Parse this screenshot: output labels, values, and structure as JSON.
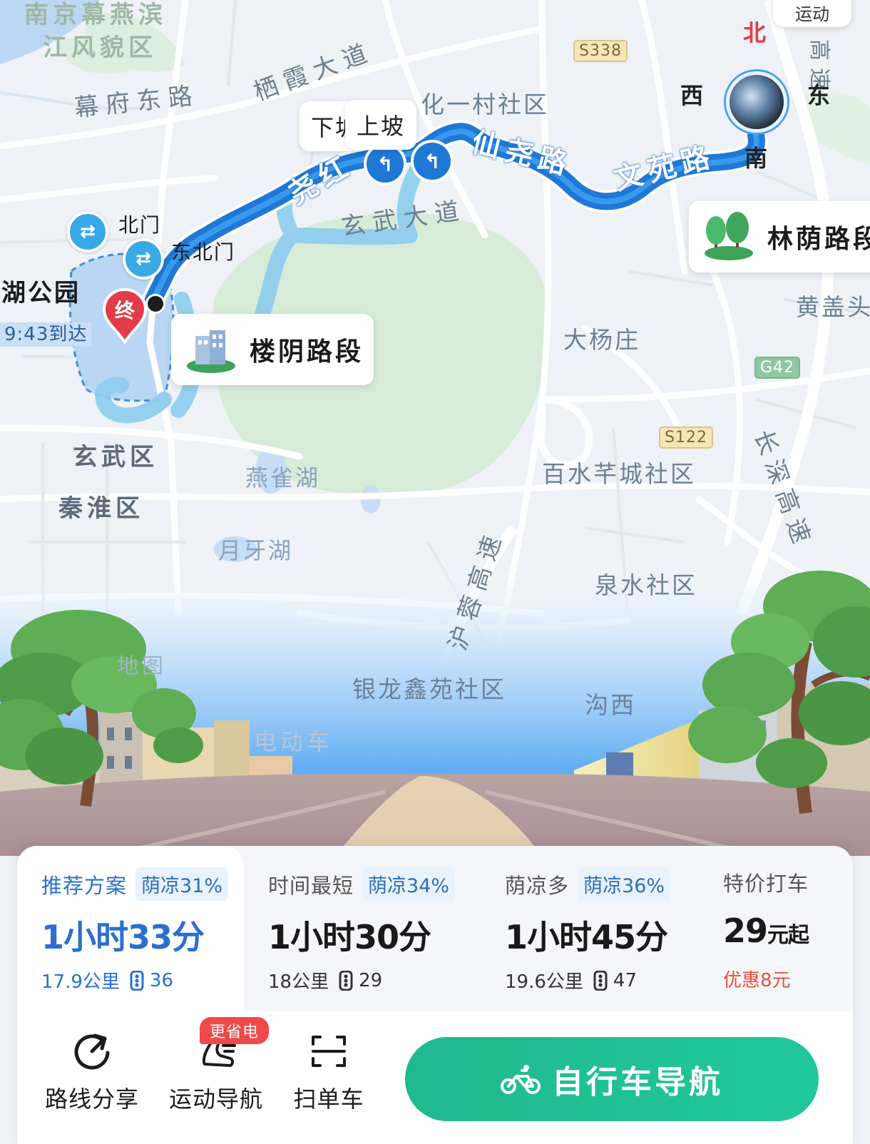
{
  "map": {
    "district_labels": [
      {
        "id": "scenic",
        "text": "南京幕燕滨"
      },
      {
        "id": "scenic2",
        "text": "江风貌区"
      },
      {
        "id": "xuanwu",
        "text": "玄武区"
      },
      {
        "id": "qinhuai",
        "text": "秦淮区"
      }
    ],
    "community_labels": [
      {
        "id": "c1",
        "text": "化一村社区"
      },
      {
        "id": "c2",
        "text": "大杨庄"
      },
      {
        "id": "c3",
        "text": "百水芊城社区"
      },
      {
        "id": "c4",
        "text": "泉水社区"
      },
      {
        "id": "c5",
        "text": "银龙鑫苑社区"
      },
      {
        "id": "c6",
        "text": "沟西"
      },
      {
        "id": "c7",
        "text": "黄盖头"
      }
    ],
    "road_labels": [
      {
        "id": "r1",
        "text": "幕府东路"
      },
      {
        "id": "r2",
        "text": "栖霞大道"
      },
      {
        "id": "r3",
        "text": "玄武大道"
      },
      {
        "id": "r4",
        "text": "长深高速"
      },
      {
        "id": "r5",
        "text": "沪蓉高速"
      },
      {
        "id": "r6",
        "text": "高速"
      }
    ],
    "route_road_labels": [
      {
        "id": "rr1",
        "text": "尧红"
      },
      {
        "id": "rr2",
        "text": "仙尧路"
      },
      {
        "id": "rr3",
        "text": "文苑路"
      }
    ],
    "water_labels": [
      {
        "id": "w1",
        "text": "燕雀湖"
      },
      {
        "id": "w2",
        "text": "月牙湖"
      }
    ],
    "place_labels": [
      {
        "id": "p1",
        "text": "湖公园"
      },
      {
        "id": "p2",
        "text": "北门"
      },
      {
        "id": "p3",
        "text": "东北门"
      },
      {
        "id": "p4",
        "text": "地图"
      },
      {
        "id": "p5",
        "text": "电动车"
      }
    ],
    "shields": [
      {
        "id": "s338",
        "text": "S338"
      },
      {
        "id": "s122",
        "text": "S122"
      },
      {
        "id": "g42",
        "text": "G42"
      }
    ],
    "arrival_text": "9:43到达",
    "end_marker": "终",
    "compass": {
      "north": "北",
      "south": "南",
      "east": "东",
      "west": "西"
    },
    "top_pill": "运动",
    "slope_down": "下坡",
    "slope_up": "上坡",
    "metro_glyph": "⇄",
    "callouts": {
      "shade_segment_1": "林荫路段",
      "shade_segment_2": "楼阴路段"
    }
  },
  "route_options": [
    {
      "name": "推荐方案",
      "tag": "荫凉31%",
      "time": "1小时33分",
      "distance": "17.9公里",
      "lights": "36",
      "selected": true
    },
    {
      "name": "时间最短",
      "tag": "荫凉34%",
      "time": "1小时30分",
      "distance": "18公里",
      "lights": "29",
      "selected": false
    },
    {
      "name": "荫凉多",
      "tag": "荫凉36%",
      "time": "1小时45分",
      "distance": "19.6公里",
      "lights": "47",
      "selected": false
    }
  ],
  "taxi_option": {
    "name": "特价打车",
    "price": "29",
    "price_unit": "元起",
    "discount": "优惠8元"
  },
  "actions": [
    {
      "id": "share",
      "label": "路线分享"
    },
    {
      "id": "sport",
      "label": "运动导航",
      "badge": "更省电"
    },
    {
      "id": "scan",
      "label": "扫单车"
    }
  ],
  "primary_button": {
    "label": "自行车导航"
  },
  "colors": {
    "route": "#1f78d6",
    "route_alt": "#8fcff0",
    "accent_blue": "#2a6fd0",
    "nav_green": "#20c095",
    "discount_red": "#e2513c",
    "park_green": "#d5ecd9"
  }
}
